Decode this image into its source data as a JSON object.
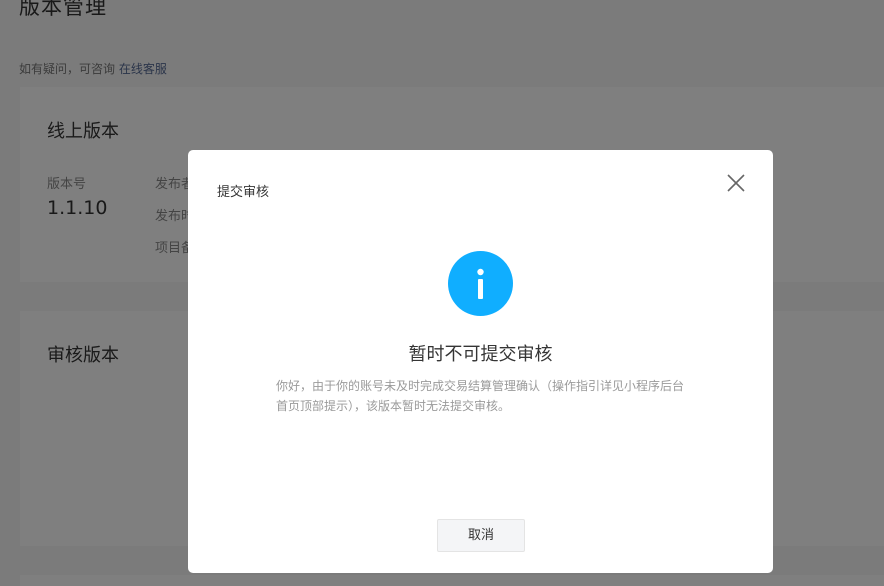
{
  "page": {
    "title": "版本管理",
    "help_prefix": "如有疑问，可咨询 ",
    "help_link": "在线客服"
  },
  "online_version": {
    "title": "线上版本",
    "version_label": "版本号",
    "version_value": "1.1.10",
    "meta": [
      "发布者",
      "发布时间",
      "项目备注"
    ]
  },
  "audit_version": {
    "title": "审核版本"
  },
  "dialog": {
    "title": "提交审核",
    "close_icon": "close-icon",
    "status_icon": "info-icon",
    "icon_color": "#10aeff",
    "heading": "暂时不可提交审核",
    "body": "你好，由于你的账号未及时完成交易结算管理确认（操作指引详见小程序后台首页顶部提示），该版本暂时无法提交审核。",
    "cancel_label": "取消"
  }
}
